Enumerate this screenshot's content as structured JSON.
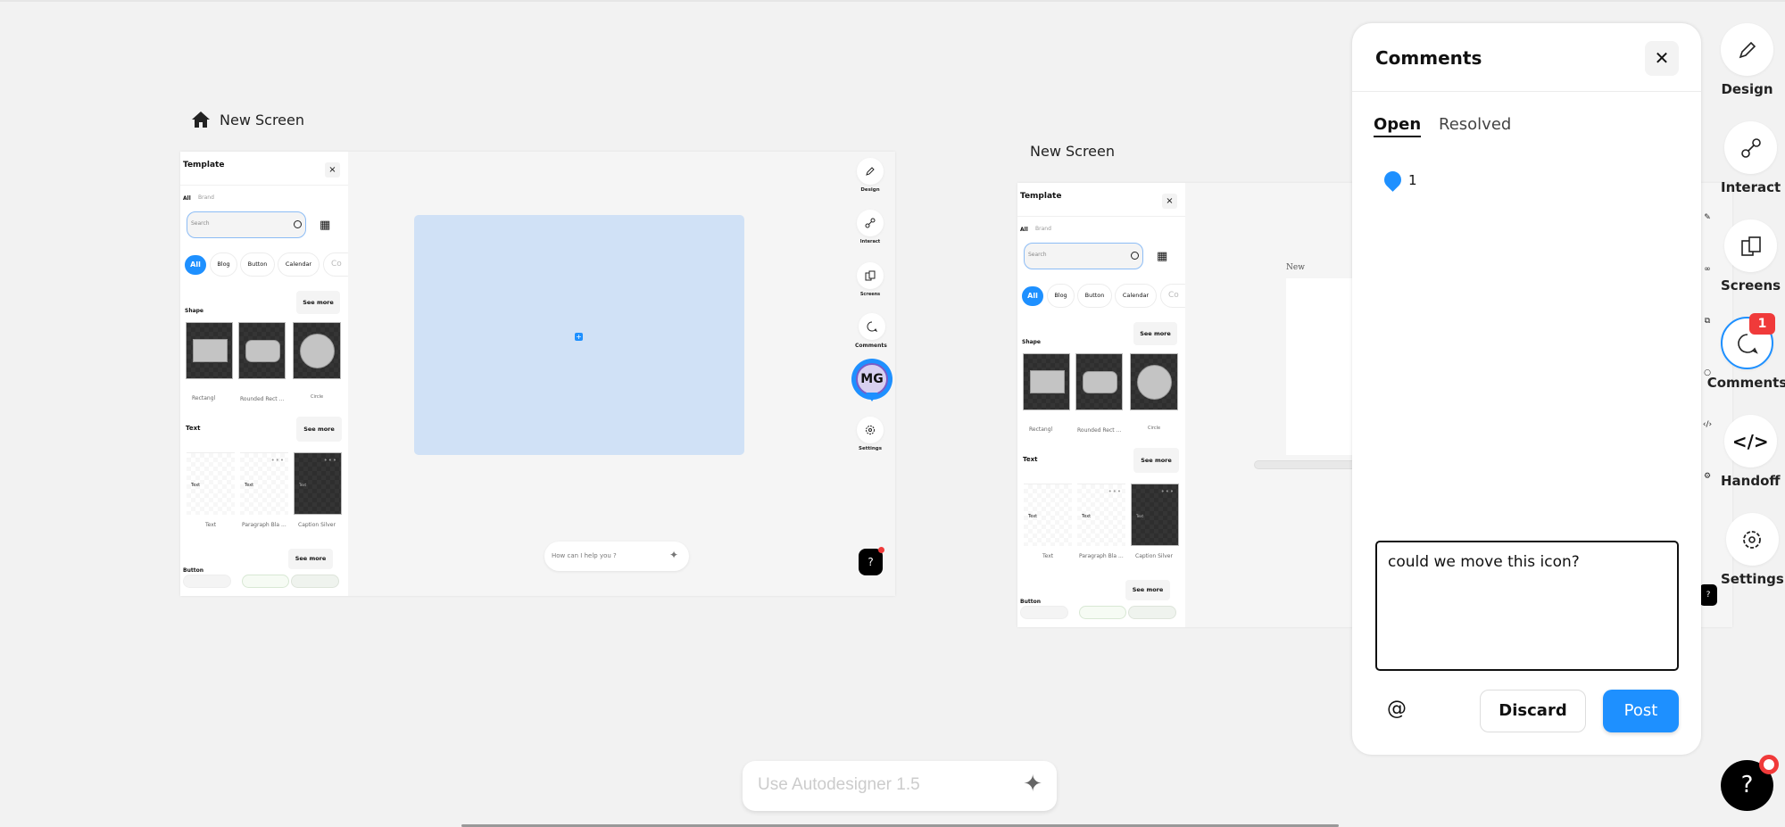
{
  "canvas": {
    "screens": [
      {
        "title": "New Screen"
      },
      {
        "title": "New Screen",
        "inner_label": "New"
      }
    ]
  },
  "template_panel": {
    "title": "Template",
    "close": "×",
    "tabs": [
      "All",
      "Brand"
    ],
    "search_placeholder": "Search",
    "chips": [
      "All",
      "Blog",
      "Button",
      "Calendar",
      "Co"
    ],
    "see_more": "See more",
    "sections": {
      "shape": {
        "label": "Shape",
        "items": [
          "Rectangl",
          "Rounded Rect ...",
          "Circle"
        ]
      },
      "text": {
        "label": "Text",
        "items": [
          "Text",
          "Paragraph Bla ...",
          "Caption Silver"
        ],
        "thumb_text": "Text"
      },
      "button": {
        "label": "Button"
      }
    }
  },
  "screen1": {
    "toolbar": [
      "Design",
      "Interact",
      "Screens",
      "Comments",
      "Settings"
    ],
    "avatar": "MG",
    "chat_placeholder": "How can I help you ?",
    "help": "?"
  },
  "comments": {
    "title": "Comments",
    "tabs": [
      "Open",
      "Resolved"
    ],
    "active_tab": "Open",
    "pin_number": "1",
    "draft": "could we move this icon?",
    "mention": "@",
    "discard": "Discard",
    "post": "Post"
  },
  "right_toolbar": {
    "items": [
      "Design",
      "Interact",
      "Screens",
      "Comments",
      "Handoff",
      "Settings"
    ],
    "comments_badge": "1",
    "help": "?"
  },
  "autodesigner": {
    "placeholder": "Use Autodesigner 1.5"
  },
  "colors": {
    "accent": "#1e90ff",
    "badge": "#f03a3a",
    "canvas_blue": "#d0e1f6",
    "avatar_bg": "#d8d0f0"
  }
}
